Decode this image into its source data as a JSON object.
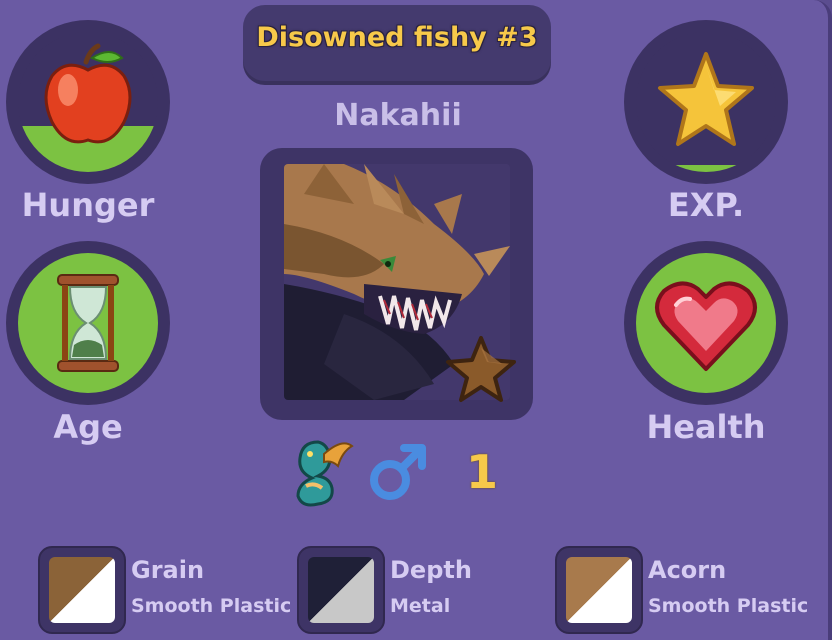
{
  "pet": {
    "title": "Disowned fishy #3",
    "name": "Nakahii",
    "level": "1",
    "gender": "male",
    "rarity_star": "bronze-star"
  },
  "stats": {
    "hunger": {
      "label": "Hunger",
      "icon": "apple-icon",
      "fill": 0.33
    },
    "exp": {
      "label": "EXP.",
      "icon": "star-icon",
      "fill": 0.05
    },
    "age": {
      "label": "Age",
      "icon": "hourglass-icon",
      "fill": 1.0
    },
    "health": {
      "label": "Health",
      "icon": "heart-icon",
      "fill": 1.0
    }
  },
  "materials": [
    {
      "name": "Grain",
      "type": "Smooth Plastic",
      "color_a": "#8b6338",
      "color_b": "#ffffff"
    },
    {
      "name": "Depth",
      "type": "Metal",
      "color_a": "#1f2037",
      "color_b": "#c8c8c8"
    },
    {
      "name": "Acorn",
      "type": "Smooth Plastic",
      "color_a": "#a87a4c",
      "color_b": "#ffffff"
    }
  ],
  "colors": {
    "panel": "#6a5aa3",
    "title_text": "#f7c94a",
    "stat_fill": "#7cc242",
    "label_text": "#d6ccf2"
  }
}
